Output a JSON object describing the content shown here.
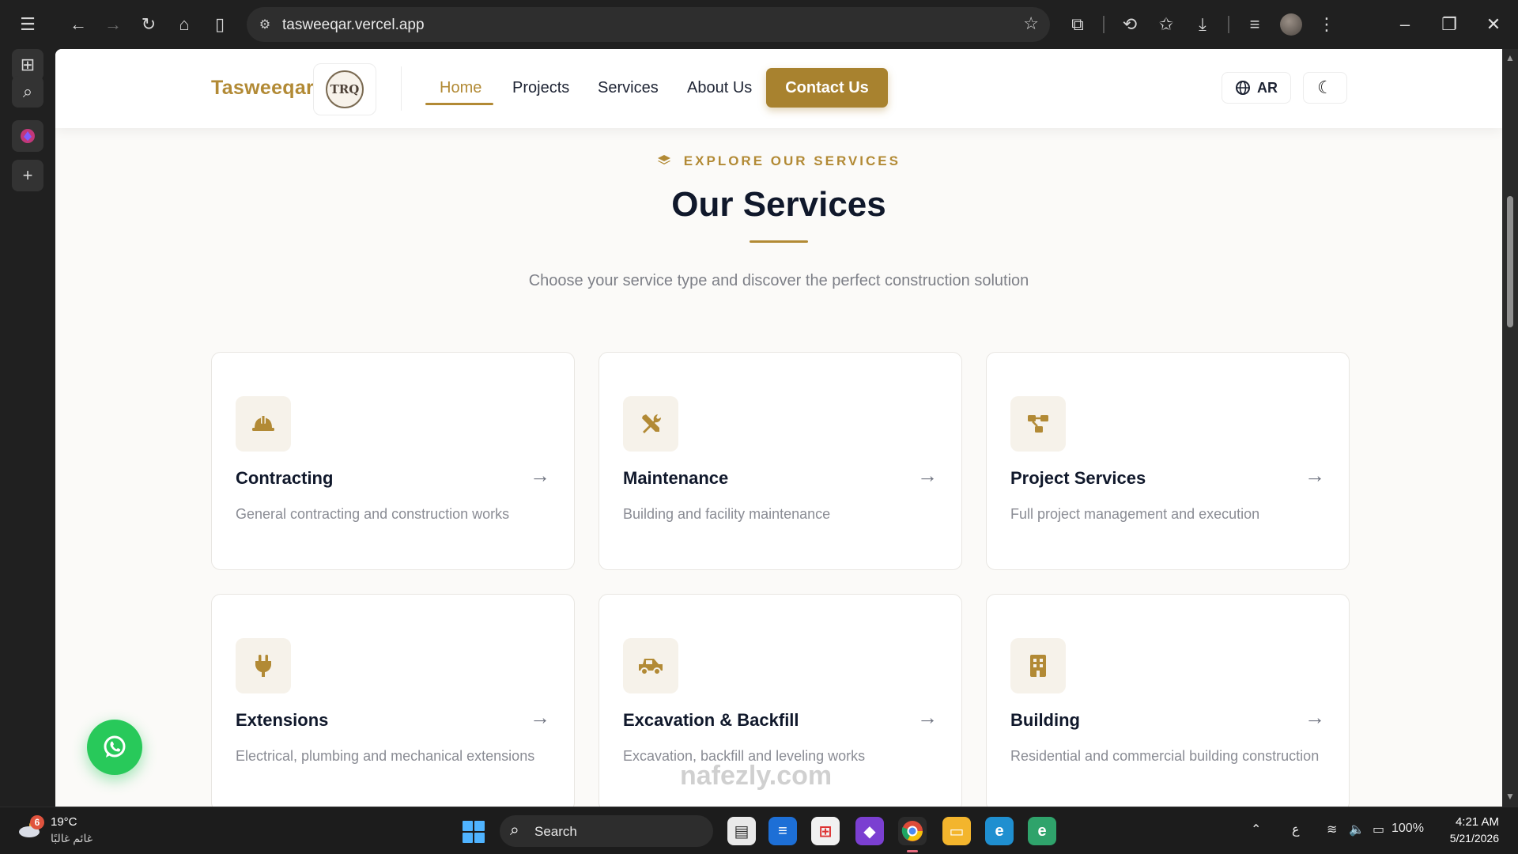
{
  "browser": {
    "url": "tasweeqar.vercel.app",
    "toolbar_icons": [
      "back-icon",
      "forward-icon",
      "reload-icon",
      "home-icon",
      "reading-view-icon",
      "star-icon",
      "extensions-icon",
      "history-icon",
      "favorites-icon",
      "downloads-icon",
      "playlist-icon",
      "more-icon"
    ]
  },
  "site": {
    "brand": "Tasweeqar",
    "logo_text": "TRQ",
    "nav": [
      {
        "label": "Home",
        "active": true
      },
      {
        "label": "Projects",
        "active": false
      },
      {
        "label": "Services",
        "active": false
      },
      {
        "label": "About Us",
        "active": false
      }
    ],
    "contact_label": "Contact Us",
    "lang_label": "AR"
  },
  "section": {
    "eyebrow": "EXPLORE OUR SERVICES",
    "title": "Our Services",
    "subtitle": "Choose your service type and discover the perfect construction solution"
  },
  "cards": [
    {
      "title": "Contracting",
      "desc": "General contracting and construction works",
      "icon": "hard-hat-icon"
    },
    {
      "title": "Maintenance",
      "desc": "Building and facility maintenance",
      "icon": "tools-icon"
    },
    {
      "title": "Project Services",
      "desc": "Full project management and execution",
      "icon": "project-diagram-icon"
    },
    {
      "title": "Extensions",
      "desc": "Electrical, plumbing and mechanical extensions",
      "icon": "plug-icon"
    },
    {
      "title": "Excavation & Backfill",
      "desc": "Excavation, backfill and leveling works",
      "icon": "truck-icon"
    },
    {
      "title": "Building",
      "desc": "Residential and commercial building construction",
      "icon": "building-icon"
    }
  ],
  "taskbar": {
    "weather_badge": "6",
    "weather_temp": "19°C",
    "weather_desc": "غائم غالبًا",
    "search_label": "Search",
    "lang_indicator": "ع",
    "battery": "100%",
    "time": "4:21 AM",
    "date": "5/21/2026"
  },
  "watermark": "nafezly.com",
  "colors": {
    "accent": "#b28a35",
    "contact_bg": "#a8822f",
    "whatsapp": "#28c95a"
  }
}
